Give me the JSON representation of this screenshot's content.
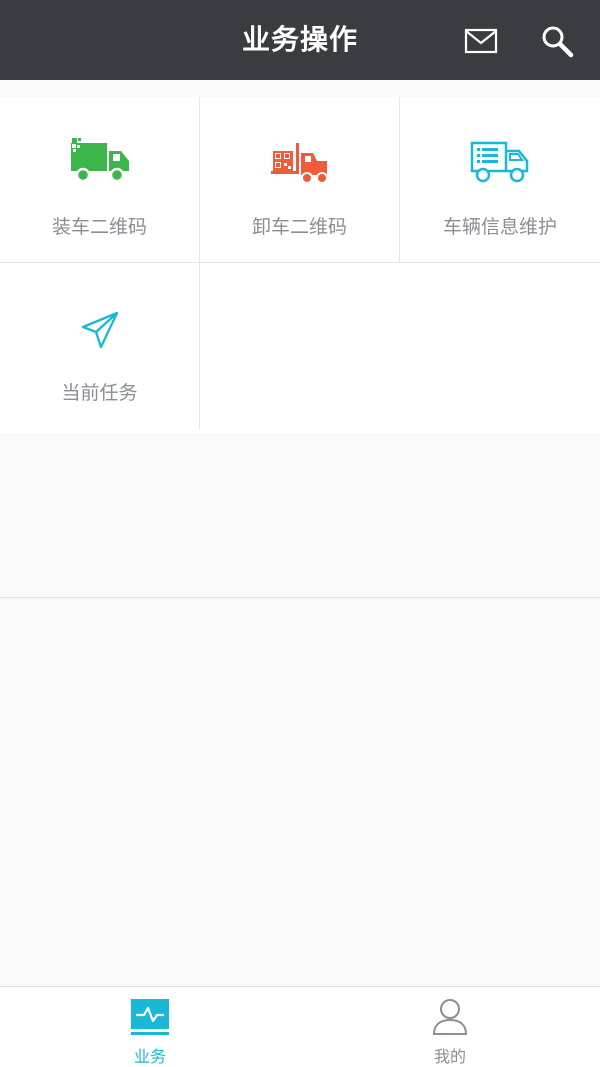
{
  "header": {
    "title": "业务操作",
    "icons": [
      "mail-icon",
      "search-icon"
    ]
  },
  "grid": {
    "items": [
      {
        "label": "装车二维码",
        "icon": "loading-truck-icon",
        "color": "#3cb54a"
      },
      {
        "label": "卸车二维码",
        "icon": "forklift-icon",
        "color": "#f15a3a"
      },
      {
        "label": "车辆信息维护",
        "icon": "truck-info-icon",
        "color": "#19b8d6"
      },
      {
        "label": "当前任务",
        "icon": "paper-plane-icon",
        "color": "#19b8d6"
      }
    ]
  },
  "bottom_nav": {
    "items": [
      {
        "label": "业务",
        "icon": "pulse-icon",
        "active": true,
        "color": "#19b8d6"
      },
      {
        "label": "我的",
        "icon": "user-icon",
        "active": false,
        "color": "#8a8f96"
      }
    ]
  },
  "colors": {
    "header_bg": "#393d42",
    "accent": "#19b8d6",
    "page_bg": "#f9f9f9"
  }
}
